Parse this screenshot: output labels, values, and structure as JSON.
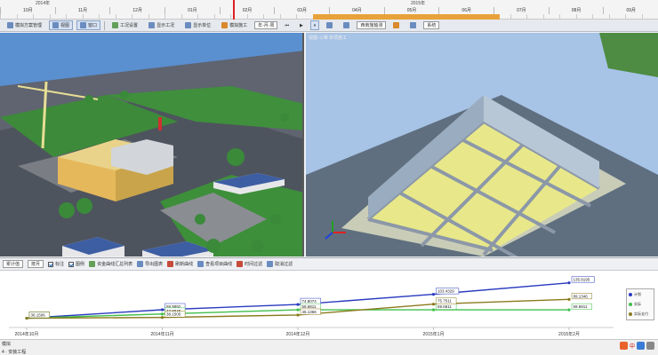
{
  "timeline": {
    "years": [
      "2014年",
      "2015年"
    ],
    "months": [
      "10月",
      "11月",
      "12月",
      "01月",
      "02月",
      "03月",
      "04月",
      "05月",
      "06月",
      "07月",
      "08月",
      "09月"
    ]
  },
  "toolbar": {
    "items": [
      {
        "label": "模拟方案管理",
        "icon": "list-icon"
      },
      {
        "label": "视图",
        "icon": "view-icon"
      },
      {
        "label": "窗口",
        "icon": "window-icon"
      },
      {
        "label": "工况设置",
        "icon": "settings-icon"
      },
      {
        "label": "显示工况",
        "icon": "display-icon"
      },
      {
        "label": "显示单位",
        "icon": "unit-icon"
      },
      {
        "label": "模拟施工",
        "icon": "simulate-icon"
      }
    ],
    "dropdown1": "年-月-周",
    "dropdown2": "西南施轴测",
    "dropdown3": "系统"
  },
  "viewport_right": {
    "label": "视图-三维 单项施工"
  },
  "chart_toolbar": {
    "dropdown_type": "累计值",
    "dropdown_unit": "按月",
    "check_label_1": "标注",
    "check_label_2": "图例",
    "btn_report": "资金曲线汇总列表",
    "btn_export": "导出图表",
    "btn_refresh": "刷新曲线",
    "btn_view": "查看项目曲线",
    "btn_time": "时间过滤",
    "btn_cancel": "取消过滤"
  },
  "chart_data": {
    "type": "line",
    "categories": [
      "2014年10月",
      "2014年11月",
      "2014年12月",
      "2015年1月",
      "2015年2月"
    ],
    "series": [
      {
        "name": "计划",
        "color": "#2a3bbf",
        "values": [
          36.1506,
          59.9892,
          74.8074,
          103.4329,
          135.8195
        ]
      },
      {
        "name": "实际",
        "color": "#3fbf4a",
        "values": [
          36.1506,
          47.8845,
          59.6811,
          59.6811,
          59.6811
        ]
      },
      {
        "name": "实际支付",
        "color": "#8a7a1c",
        "values": [
          36.1506,
          38.1505,
          45.1366,
          75.7511,
          89.1346
        ]
      }
    ],
    "data_labels": [
      [
        "36.1506",
        "59.9892",
        "74.8074",
        "103.4329",
        "135.8195"
      ],
      [
        "36.1506",
        "47.8845",
        "59.6811",
        "59.6811",
        "59.6811"
      ],
      [
        "36.1506",
        "38.1505",
        "45.1366",
        "75.7511",
        "89.1346"
      ]
    ],
    "legend": [
      "计划",
      "实际",
      "实际支付"
    ],
    "legend_position": "right",
    "ylim": [
      20,
      150
    ]
  },
  "statusbar": {
    "tab": "模拟",
    "text": "4 · 安装工程"
  },
  "tray": {
    "text": "中"
  }
}
